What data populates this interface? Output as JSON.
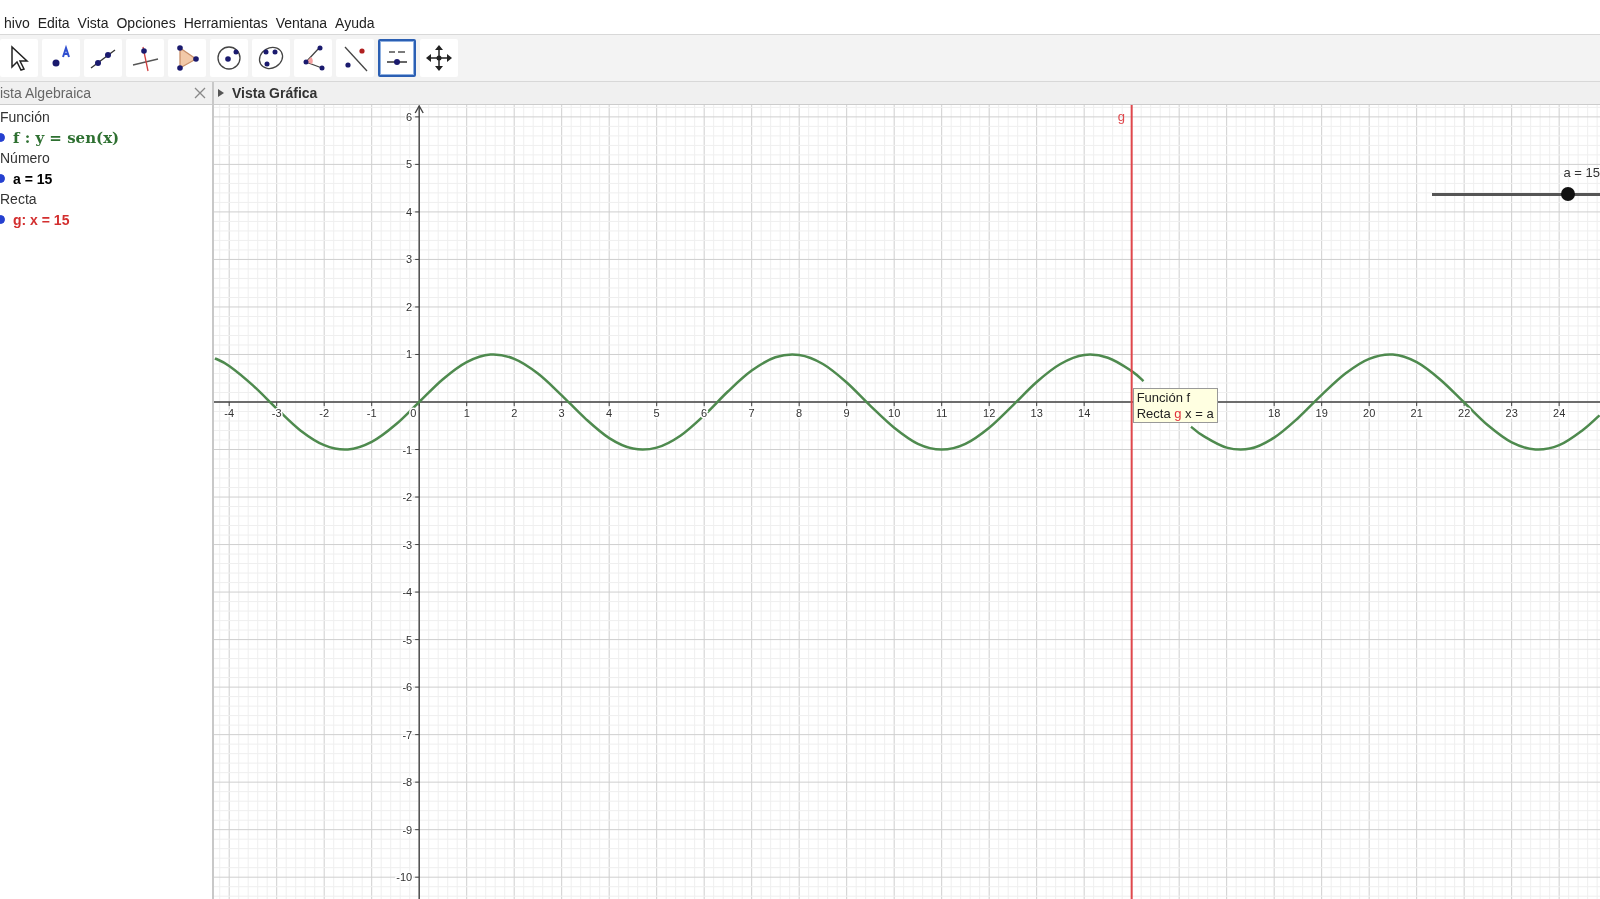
{
  "menu": [
    "hivo",
    "Edita",
    "Vista",
    "Opciones",
    "Herramientas",
    "Ventana",
    "Ayuda"
  ],
  "toolbar": [
    {
      "kind": "move",
      "selected": false
    },
    {
      "kind": "point",
      "selected": false
    },
    {
      "kind": "line",
      "selected": false
    },
    {
      "kind": "perpendicular",
      "selected": false
    },
    {
      "kind": "polygon",
      "selected": false
    },
    {
      "kind": "circle",
      "selected": false
    },
    {
      "kind": "conic",
      "selected": false
    },
    {
      "kind": "angle",
      "selected": false
    },
    {
      "kind": "reflect",
      "selected": false
    },
    {
      "kind": "slider",
      "selected": true
    },
    {
      "kind": "move-view",
      "selected": false
    }
  ],
  "algebra_view": {
    "title": "ista Algebraica",
    "groups": [
      {
        "heading": "Función",
        "items": [
          {
            "text": "f : y = sen(x)",
            "kind": "formula",
            "color": "#2e7031",
            "shown": true
          }
        ]
      },
      {
        "heading": "Número",
        "items": [
          {
            "text": "a = 15",
            "kind": "plain",
            "color": "#000000",
            "shown": true
          }
        ]
      },
      {
        "heading": "Recta",
        "items": [
          {
            "text": "g: x = 15",
            "kind": "plain",
            "color": "#d32f2f",
            "shown": true
          }
        ]
      }
    ]
  },
  "graphics_view": {
    "title": "Vista Gráfica",
    "chart_data": {
      "type": "line",
      "grid": true,
      "x": [
        -4.3,
        -4,
        -3.5,
        -3,
        -2.5,
        -2,
        -1.5,
        -1,
        -0.5,
        0,
        0.5,
        1,
        1.5,
        2,
        2.5,
        3,
        3.5,
        4,
        4.5,
        5,
        5.5,
        6,
        6.5,
        7,
        7.5,
        8,
        8.5,
        9,
        9.5,
        10,
        10.5,
        11,
        11.5,
        12,
        12.5,
        13,
        13.5,
        14,
        14.5,
        15,
        15.25,
        15.5,
        16,
        16.25,
        16.5,
        17,
        17.5,
        18,
        18.5,
        19,
        19.5,
        20,
        20.5,
        21,
        21.5,
        22,
        22.5,
        23,
        23.5,
        24,
        24.5,
        24.85
      ],
      "series": [
        {
          "color": "#4e8a4e",
          "values": [
            0.92,
            0.76,
            0.35,
            -0.14,
            -0.6,
            -0.91,
            -1.0,
            -0.84,
            -0.48,
            0,
            0.48,
            0.84,
            1.0,
            0.91,
            0.6,
            0.14,
            -0.35,
            -0.76,
            -0.98,
            -0.96,
            -0.71,
            -0.28,
            0.22,
            0.66,
            0.94,
            0.99,
            0.8,
            0.41,
            -0.08,
            -0.54,
            -0.88,
            -1.0,
            -0.88,
            -0.54,
            -0.07,
            0.42,
            0.8,
            0.99,
            0.93,
            0.65,
            0.44,
            null,
            null,
            -0.52,
            -0.71,
            -0.96,
            -0.98,
            -0.75,
            -0.34,
            0.15,
            0.6,
            0.91,
            1.0,
            0.84,
            0.47,
            -0.01,
            -0.49,
            -0.85,
            -1.0,
            -0.91,
            -0.59,
            -0.28
          ]
        }
      ],
      "xlim": [
        -4.32,
        24.86
      ],
      "ylim": [
        -10.48,
        6.25
      ],
      "xticks": [
        -4,
        -3,
        -2,
        -1,
        0,
        1,
        2,
        3,
        4,
        5,
        6,
        7,
        8,
        9,
        10,
        11,
        12,
        13,
        14,
        18,
        19,
        20,
        21,
        22,
        23,
        24
      ],
      "yticks": [
        -10,
        -9,
        -8,
        -7,
        -6,
        -5,
        -4,
        -3,
        -2,
        -1,
        1,
        2,
        3,
        4,
        5,
        6
      ],
      "ref_lines": [
        {
          "axis": "x",
          "value": 15,
          "label": "g",
          "color": "#e0474c"
        }
      ]
    },
    "slider": {
      "label": "a = 15",
      "level": 0.8
    },
    "tooltip": {
      "line_1": "Función f",
      "line_2": {
        "prefix": "Recta",
        "object": "g",
        "definition": "x = a"
      }
    }
  }
}
